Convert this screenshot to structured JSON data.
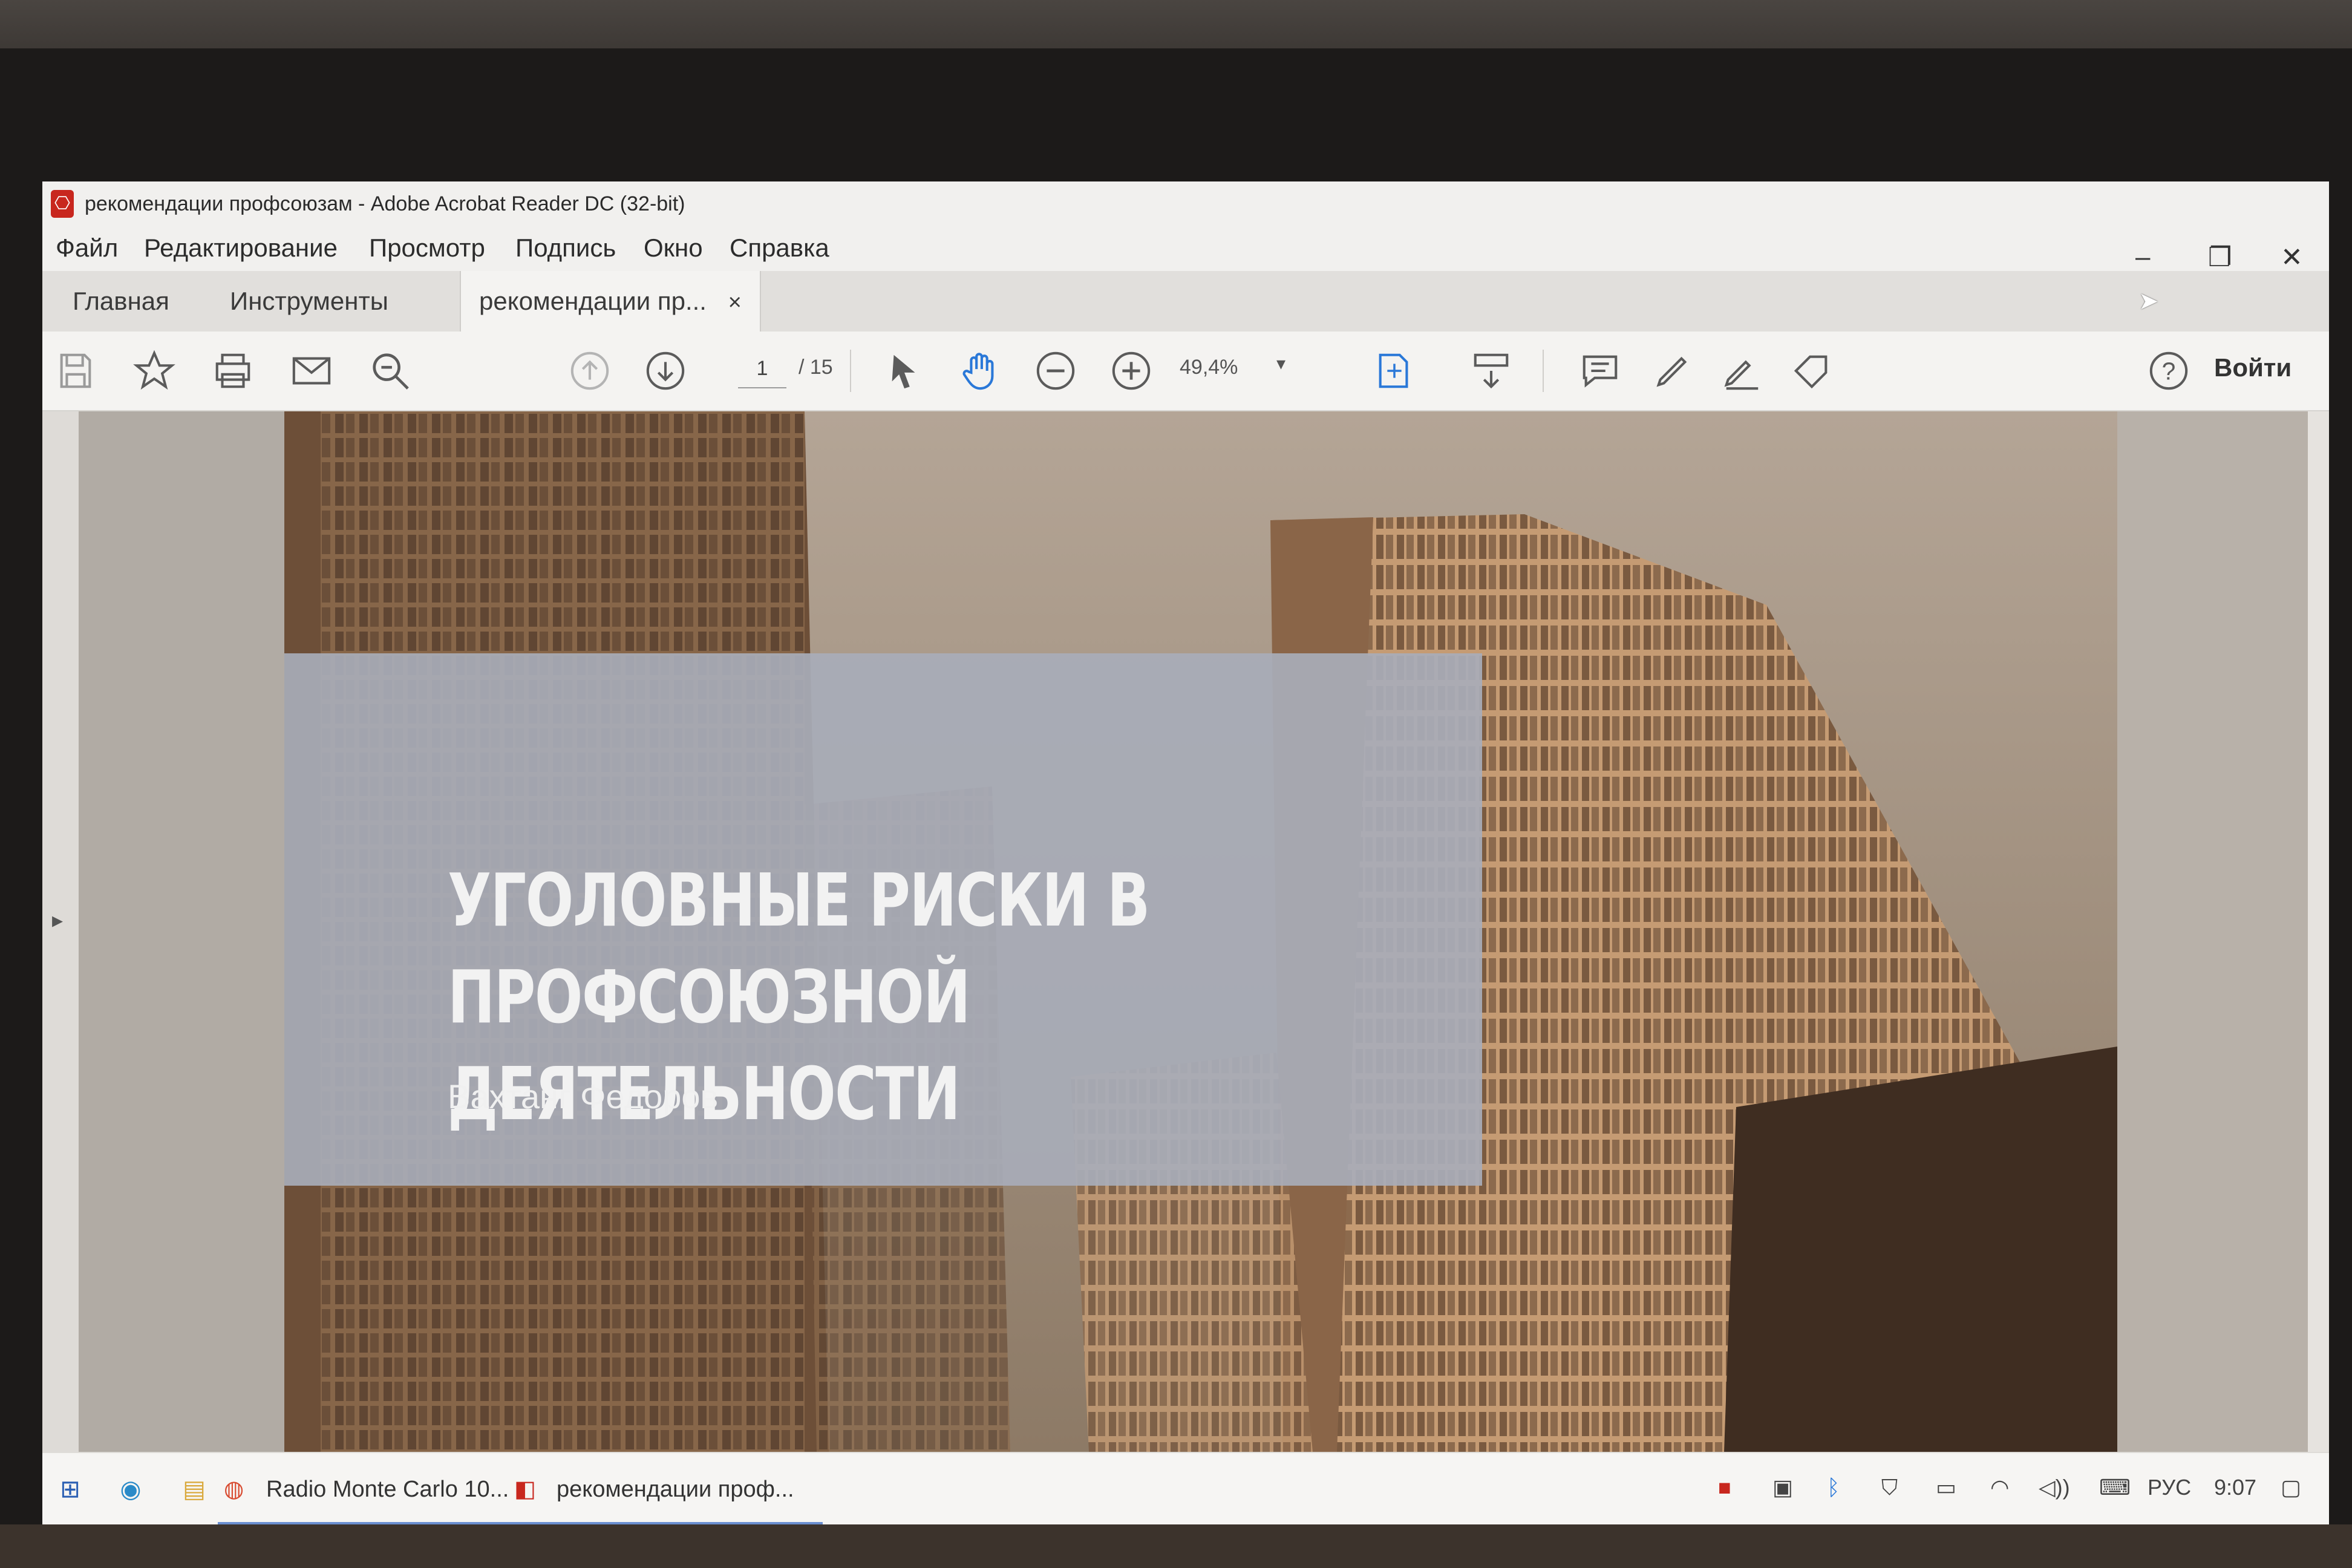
{
  "window": {
    "title": "рекомендации профсоюзам - Adobe Acrobat Reader DC (32-bit)",
    "controls": {
      "minimize": "–",
      "restore": "❐",
      "close": "✕"
    }
  },
  "menu": [
    "Файл",
    "Редактирование",
    "Просмотр",
    "Подпись",
    "Окно",
    "Справка"
  ],
  "tabs": {
    "home": "Главная",
    "tools": "Инструменты",
    "document": "рекомендации пр...",
    "document_close": "×"
  },
  "toolbar": {
    "page_current": "1",
    "page_total": "/ 15",
    "zoom": "49,4%",
    "signin": "Войти"
  },
  "slide": {
    "title": "УГОЛОВНЫЕ РИСКИ В ПРОФСОЮЗНОЙ ДЕЯТЕЛЬНОСТИ",
    "author": "Вахтанг Федоров"
  },
  "taskbar": {
    "items": [
      "Radio Monte Carlo 10...",
      "рекомендации проф..."
    ],
    "language": "РУС",
    "time": "9:07"
  },
  "colors": {
    "acrobat_red": "#c8271e",
    "tool_blue": "#2a78d8",
    "overlay": "#a8acb9"
  }
}
